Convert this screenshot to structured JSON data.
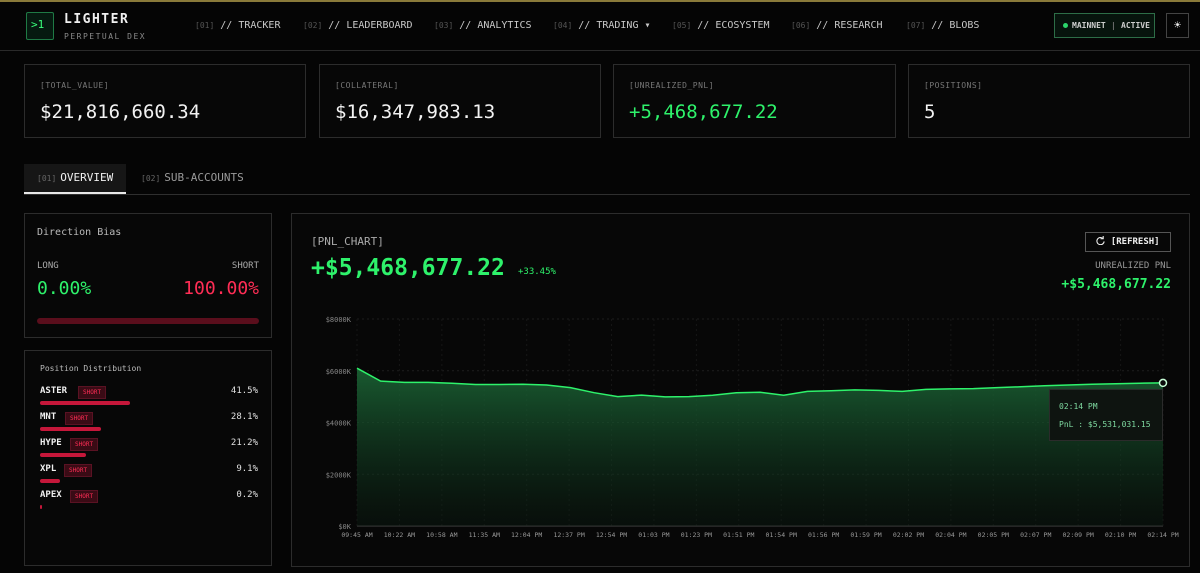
{
  "brand": {
    "name": "LIGHTER",
    "sub": "PERPETUAL DEX",
    "logo": ">1"
  },
  "nav": [
    {
      "num": "[01]",
      "label": "// TRACKER"
    },
    {
      "num": "[02]",
      "label": "// LEADERBOARD"
    },
    {
      "num": "[03]",
      "label": "// ANALYTICS"
    },
    {
      "num": "[04]",
      "label": "// TRADING ▾"
    },
    {
      "num": "[05]",
      "label": "// ECOSYSTEM"
    },
    {
      "num": "[06]",
      "label": "// RESEARCH"
    },
    {
      "num": "[07]",
      "label": "// BLOBS"
    }
  ],
  "status": {
    "network": "MAINNET",
    "sep": "|",
    "state": "ACTIVE",
    "theme_icon": "☀"
  },
  "stats": [
    {
      "label": "[TOTAL_VALUE]",
      "value": "$21,816,660.34"
    },
    {
      "label": "[COLLATERAL]",
      "value": "$16,347,983.13"
    },
    {
      "label": "[UNREALIZED_PNL]",
      "value": "+5,468,677.22"
    },
    {
      "label": "[POSITIONS]",
      "value": "5"
    }
  ],
  "tabs": [
    {
      "num": "[01]",
      "label": "OVERVIEW"
    },
    {
      "num": "[02]",
      "label": "SUB-ACCOUNTS"
    }
  ],
  "direction": {
    "title": "Direction Bias",
    "long_label": "LONG",
    "short_label": "SHORT",
    "long_value": "0.00%",
    "short_value": "100.00%"
  },
  "distribution": {
    "title": "Position Distribution",
    "items": [
      {
        "symbol": "ASTER",
        "side": "SHORT",
        "pct": "41.5%",
        "share": 41.5
      },
      {
        "symbol": "MNT",
        "side": "SHORT",
        "pct": "28.1%",
        "share": 28.1
      },
      {
        "symbol": "HYPE",
        "side": "SHORT",
        "pct": "21.2%",
        "share": 21.2
      },
      {
        "symbol": "XPL",
        "side": "SHORT",
        "pct": "9.1%",
        "share": 9.1
      },
      {
        "symbol": "APEX",
        "side": "SHORT",
        "pct": "0.2%",
        "share": 0.2
      }
    ]
  },
  "pnl_chart": {
    "label": "[PNL_CHART]",
    "value": "+$5,468,677.22",
    "change": "+33.45%",
    "refresh_label": "[REFRESH]",
    "unrealized_label": "UNREALIZED PNL",
    "unrealized_value": "+$5,468,677.22",
    "tooltip_time": "02:14 PM",
    "tooltip_pnl": "PnL : $5,531,031.15"
  },
  "chart_data": {
    "type": "area",
    "y_ticks": [
      "$8000K",
      "$6000K",
      "$4000K",
      "$2000K",
      "$0K"
    ],
    "ylim": [
      0,
      8000
    ],
    "x_ticks": [
      "09:45 AM",
      "10:22 AM",
      "10:58 AM",
      "11:35 AM",
      "12:04 PM",
      "12:37 PM",
      "12:54 PM",
      "01:03 PM",
      "01:23 PM",
      "01:51 PM",
      "01:54 PM",
      "01:56 PM",
      "01:59 PM",
      "02:02 PM",
      "02:04 PM",
      "02:05 PM",
      "02:07 PM",
      "02:09 PM",
      "02:10 PM",
      "02:14 PM"
    ],
    "values": [
      6100,
      5600,
      5550,
      5550,
      5520,
      5470,
      5470,
      5480,
      5450,
      5350,
      5150,
      5000,
      5060,
      4990,
      5000,
      5050,
      5150,
      5170,
      5050,
      5200,
      5230,
      5260,
      5240,
      5200,
      5280,
      5300,
      5310,
      5350,
      5380,
      5420,
      5450,
      5480,
      5500,
      5520,
      5531
    ],
    "line_color": "#2ef26b"
  }
}
